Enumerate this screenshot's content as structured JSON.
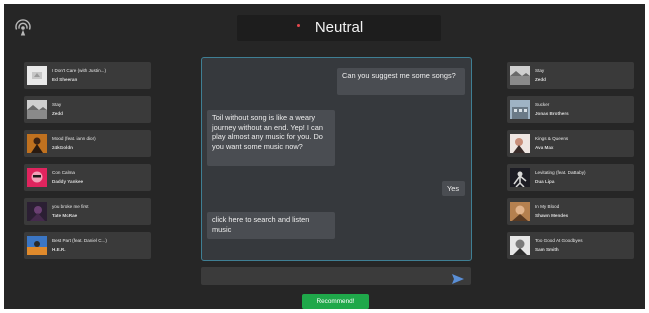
{
  "header": {
    "mood_label": "Neutral",
    "radio_icon": "radio-broadcast-icon"
  },
  "left_songs": [
    {
      "title": "I Don't Care (with Justin...)",
      "artist": "Ed Sheeran",
      "thumb": "album-art-white"
    },
    {
      "title": "Stay",
      "artist": "Zedd",
      "thumb": "album-art-landscape"
    },
    {
      "title": "Mood (feat. iann dior)",
      "artist": "24kGoldn",
      "thumb": "album-art-orange-figure"
    },
    {
      "title": "Con Calma",
      "artist": "Daddy Yankee",
      "thumb": "album-art-pink-face"
    },
    {
      "title": "you broke me first",
      "artist": "Tate McRae",
      "thumb": "album-art-dark-purple"
    },
    {
      "title": "Best Part (feat. Daniel C...)",
      "artist": "H.E.R.",
      "thumb": "album-art-blue-orange"
    }
  ],
  "right_songs": [
    {
      "title": "Stay",
      "artist": "Zedd",
      "thumb": "album-art-landscape"
    },
    {
      "title": "Sucker",
      "artist": "Jonas Brothers",
      "thumb": "album-art-building"
    },
    {
      "title": "Kings & Queens",
      "artist": "Ava Max",
      "thumb": "album-art-portrait-light"
    },
    {
      "title": "Levitating (feat. DaBaby)",
      "artist": "Dua Lipa",
      "thumb": "album-art-figure-dark"
    },
    {
      "title": "In My Blood",
      "artist": "Shawn Mendes",
      "thumb": "album-art-warm-portrait"
    },
    {
      "title": "Too Good At Goodbyes",
      "artist": "Sam Smith",
      "thumb": "album-art-bw-portrait"
    }
  ],
  "chat": {
    "messages": [
      {
        "from": "user",
        "text": "Can you suggest me some songs?"
      },
      {
        "from": "bot",
        "text": "Toil without song is like a weary journey without an end. Yep! I can play almost any music for you. Do you want some music now?"
      },
      {
        "from": "user",
        "text": "Yes"
      },
      {
        "from": "bot",
        "text": "click here to search and listen music"
      }
    ],
    "input_value": "",
    "input_placeholder": "",
    "send_icon": "send-arrow-icon"
  },
  "actions": {
    "recommend_label": "Recommend!"
  },
  "colors": {
    "background": "#262626",
    "card": "#3a3a3a",
    "chat_panel": "#36393d",
    "chat_border": "#3f7f94",
    "bubble": "#4a4d52",
    "accent_green": "#1fa84a",
    "send_blue": "#5a8fd6",
    "mood_dot": "#e5484d"
  }
}
